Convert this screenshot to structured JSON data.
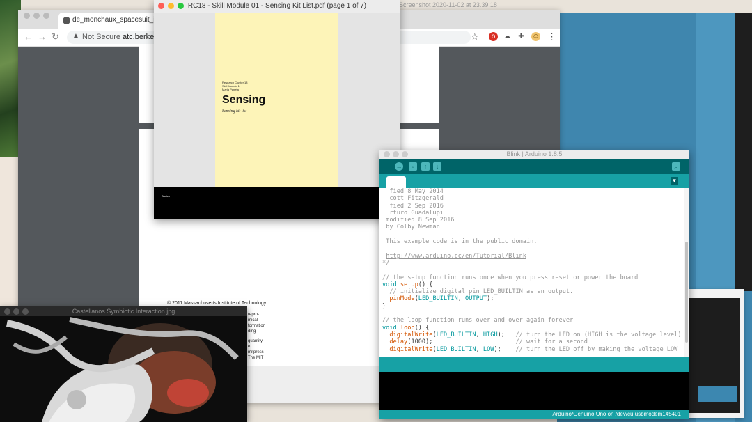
{
  "menubar": {
    "screenshot_label": "Screenshot 2020-11-02 at 23.39.18"
  },
  "chrome": {
    "tab_title": "de_monchaux_spacesuit_intro",
    "security_label": "Not Secure",
    "url": "atc.berkel",
    "copyright": "© 2011 Massachusetts Institute of Technology",
    "snippet_lines": [
      "repro-",
      "mical",
      "formation",
      "ding",
      "",
      "quantity",
      "e.",
      "mitpress",
      "The MIT"
    ]
  },
  "preview": {
    "title": "RC18 - Skill Module 01 - Sensing Kit List.pdf (page 1 of 7)",
    "meta_lines": [
      "Research Cluster 18",
      "Skill Module 1",
      "Maria Paneta"
    ],
    "heading": "Sensing",
    "subtitle": "Sensing kit list",
    "footer_text": "Basics"
  },
  "image_viewer": {
    "title": "Castellanos Symbiotic Interaction.jpg"
  },
  "arduino": {
    "title": "Blink | Arduino 1.8.5",
    "board_status": "Arduino/Genuino Uno on /dev/cu.usbmodem145401"
  },
  "colors": {
    "arduino_dark": "#006468",
    "arduino_teal": "#17a1a5",
    "pdf_page": "#fdf4b8",
    "desktop_blue": "#3f86ae"
  }
}
